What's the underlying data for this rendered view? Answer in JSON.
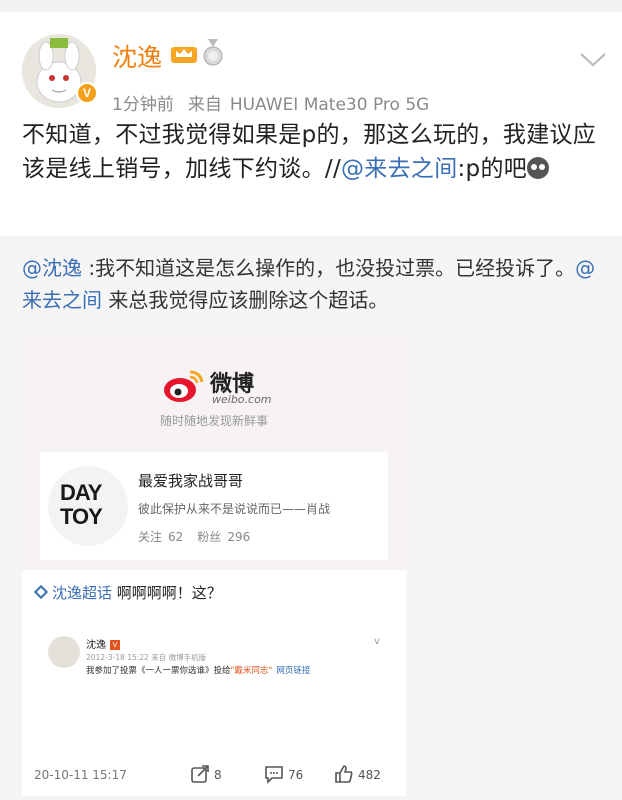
{
  "post": {
    "author": "沈逸",
    "time_ago": "1分钟前",
    "source_prefix": "来自",
    "device": "HUAWEI Mate30 Pro 5G",
    "text_part1": "不知道，不过我觉得如果是p的，那这么玩的，我建议应该是线上销号，加线下约谈。//",
    "mention": "@来去之间",
    "text_part2": ":p的吧"
  },
  "repost": {
    "mention1": "@沈逸",
    "text1": " :我不知道这是怎么操作的，也没投过票。已经投诉了。",
    "mention2": "@来去之间",
    "text2": " 来总我觉得应该删除这个超话。"
  },
  "screenshot": {
    "weibo_name": "微博",
    "weibo_url": "weibo.com",
    "slogan": "随时随地发现新鲜事",
    "card": {
      "logo_line1": "DAY",
      "logo_line2": "TOY",
      "title": "最爱我家战哥哥",
      "desc": "彼此保护从来不是说说而已——肖战",
      "follow_label": "关注",
      "follow_count": "62",
      "fans_label": "粉丝",
      "fans_count": "296"
    },
    "topic_tag": "沈逸超话",
    "topic_text": " 啊啊啊啊！这？",
    "inner": {
      "name": "沈逸",
      "badge": "V",
      "meta": "2012-3-18 15:22 来自 微博手机版",
      "text_prefix": "我参加了投票《一人一票你选谁》投给",
      "highlight": "\"戴米同志\"",
      "link": "网页链接",
      "chevron": "v"
    },
    "footer": {
      "time": "20-10-11 15:17",
      "shares": "8",
      "comments": "76",
      "likes": "482"
    }
  },
  "colors": {
    "username": "#f07f10",
    "mention": "#3a6fb5",
    "meta": "#8a8a8a",
    "repost_bg": "#f5f5f5"
  },
  "icons": [
    "crown-badge-icon",
    "medal-icon",
    "chevron-down-icon",
    "weibo-logo-icon",
    "share-icon",
    "comment-icon",
    "like-icon"
  ]
}
